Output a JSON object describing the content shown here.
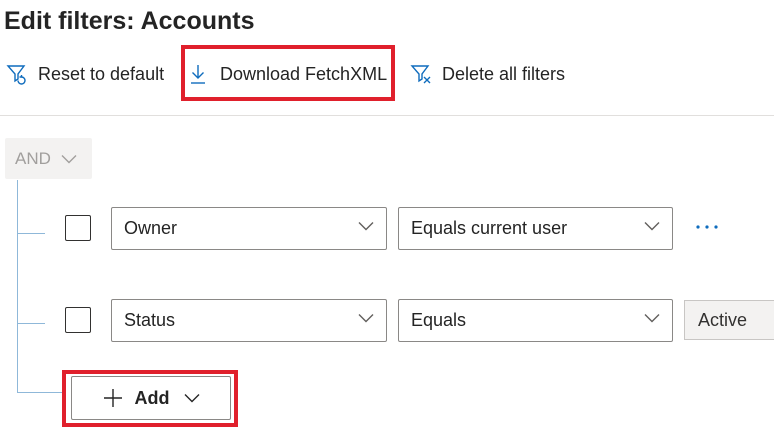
{
  "header": {
    "title": "Edit filters: Accounts"
  },
  "toolbar": {
    "reset_label": "Reset to default",
    "download_label": "Download FetchXML",
    "delete_label": "Delete all filters"
  },
  "group": {
    "operator": "AND"
  },
  "rows": [
    {
      "field": "Owner",
      "operator": "Equals current user",
      "value": ""
    },
    {
      "field": "Status",
      "operator": "Equals",
      "value": "Active"
    }
  ],
  "add": {
    "label": "Add"
  },
  "icons": {
    "reset": "filter-reset-icon",
    "download": "download-icon",
    "delete": "filter-delete-icon",
    "chevron": "chevron-down-icon",
    "more": "more-options-icon",
    "plus": "plus-icon"
  },
  "colors": {
    "accent": "#0f6cbd",
    "highlight": "#e0202c",
    "tree_line": "#8fb8d9"
  }
}
